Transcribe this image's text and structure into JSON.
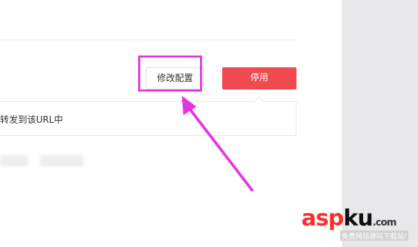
{
  "actions": {
    "modify_label": "修改配置",
    "disable_label": "停用"
  },
  "info": {
    "text": "转发到该URL中"
  },
  "watermark": {
    "brand_prefix": "asp",
    "brand_suffix": "ku",
    "domain": ".com",
    "tagline": "免费网站源码下载站!"
  },
  "colors": {
    "disable_button": "#ef4a4f",
    "highlight": "#e535e3",
    "arrow": "#e535e3"
  }
}
